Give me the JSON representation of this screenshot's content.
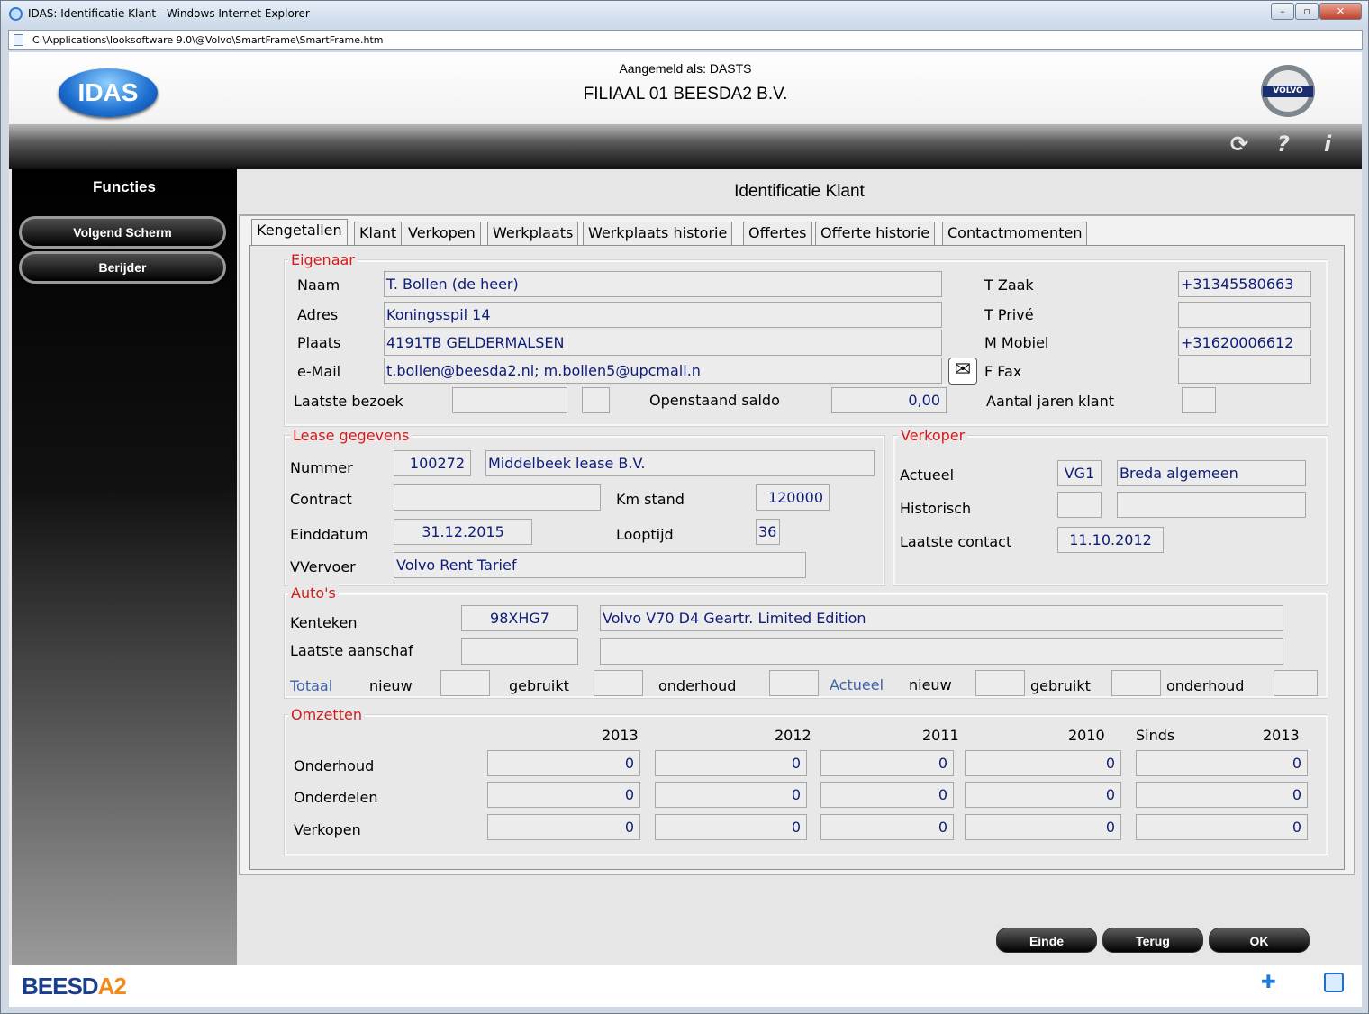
{
  "window": {
    "title": "IDAS: Identificatie Klant - Windows Internet Explorer",
    "address": "C:\\Applications\\looksoftware 9.0\\@Volvo\\SmartFrame\\SmartFrame.htm"
  },
  "header": {
    "logo": "IDAS",
    "logged_in": "Aangemeld als: DASTS",
    "branch": "FILIAAL 01 BEESDA2 B.V.",
    "volvo": "VOLVO"
  },
  "toolbar": {
    "refresh": "⟳",
    "help": "?",
    "info": "i"
  },
  "sidebar": {
    "title": "Functies",
    "items": [
      "Volgend Scherm",
      "Berijder"
    ]
  },
  "page": {
    "title": "Identificatie Klant"
  },
  "tabs": [
    "Kengetallen",
    "Klant",
    "Verkopen",
    "Werkplaats",
    "Werkplaats historie",
    "Offertes",
    "Offerte historie",
    "Contactmomenten"
  ],
  "eigenaar": {
    "title": "Eigenaar",
    "naam_label": "Naam",
    "naam": "T. Bollen (de heer)",
    "adres_label": "Adres",
    "adres": "Koningsspil 14",
    "plaats_label": "Plaats",
    "plaats": "4191TB GELDERMALSEN",
    "email_label": "e-Mail",
    "email": "t.bollen@beesda2.nl; m.bollen5@upcmail.n",
    "tzaak_label": "T Zaak",
    "tzaak": "+31345580663",
    "tprive_label": "T Privé",
    "tprive": "",
    "mmobiel_label": "M Mobiel",
    "mmobiel": "+31620006612",
    "ffax_label": "F Fax",
    "ffax": "",
    "laatste_bezoek_label": "Laatste bezoek",
    "laatste_bezoek": "",
    "openstaand_label": "Openstaand saldo",
    "openstaand": "0,00",
    "aantal_jaren_label": "Aantal jaren klant",
    "aantal_jaren": ""
  },
  "lease": {
    "title": "Lease gegevens",
    "nummer_label": "Nummer",
    "nummer": "100272",
    "naam": "Middelbeek lease B.V.",
    "contract_label": "Contract",
    "contract": "",
    "kmstand_label": "Km stand",
    "kmstand": "120000",
    "einddatum_label": "Einddatum",
    "einddatum": "31.12.2015",
    "looptijd_label": "Looptijd",
    "looptijd": "36",
    "vvervoer_label": "VVervoer",
    "vvervoer": "Volvo Rent Tarief"
  },
  "verkoper": {
    "title": "Verkoper",
    "actueel_label": "Actueel",
    "actueel_code": "VG1",
    "actueel_naam": "Breda algemeen",
    "historisch_label": "Historisch",
    "laatste_contact_label": "Laatste contact",
    "laatste_contact": "11.10.2012"
  },
  "autos": {
    "title": "Auto's",
    "kenteken_label": "Kenteken",
    "kenteken": "98XHG7",
    "model": "Volvo V70 D4 Geartr. Limited Edition",
    "aanschaf_label": "Laatste aanschaf",
    "totaal": "Totaal",
    "actueel": "Actueel",
    "nieuw": "nieuw",
    "gebruikt": "gebruikt",
    "onderhoud": "onderhoud"
  },
  "omzetten": {
    "title": "Omzetten",
    "years": [
      "2013",
      "2012",
      "2011",
      "2010"
    ],
    "sinds": "Sinds",
    "sinds_year": "2013",
    "rows": [
      {
        "label": "Onderhoud",
        "values": [
          "0",
          "0",
          "0",
          "0",
          "0"
        ]
      },
      {
        "label": "Onderdelen",
        "values": [
          "0",
          "0",
          "0",
          "0",
          "0"
        ]
      },
      {
        "label": "Verkopen",
        "values": [
          "0",
          "0",
          "0",
          "0",
          "0"
        ]
      }
    ]
  },
  "buttons": {
    "einde": "Einde",
    "terug": "Terug",
    "ok": "OK"
  },
  "footer": {
    "brand_a": "BEESD",
    "brand_b": "A2"
  }
}
